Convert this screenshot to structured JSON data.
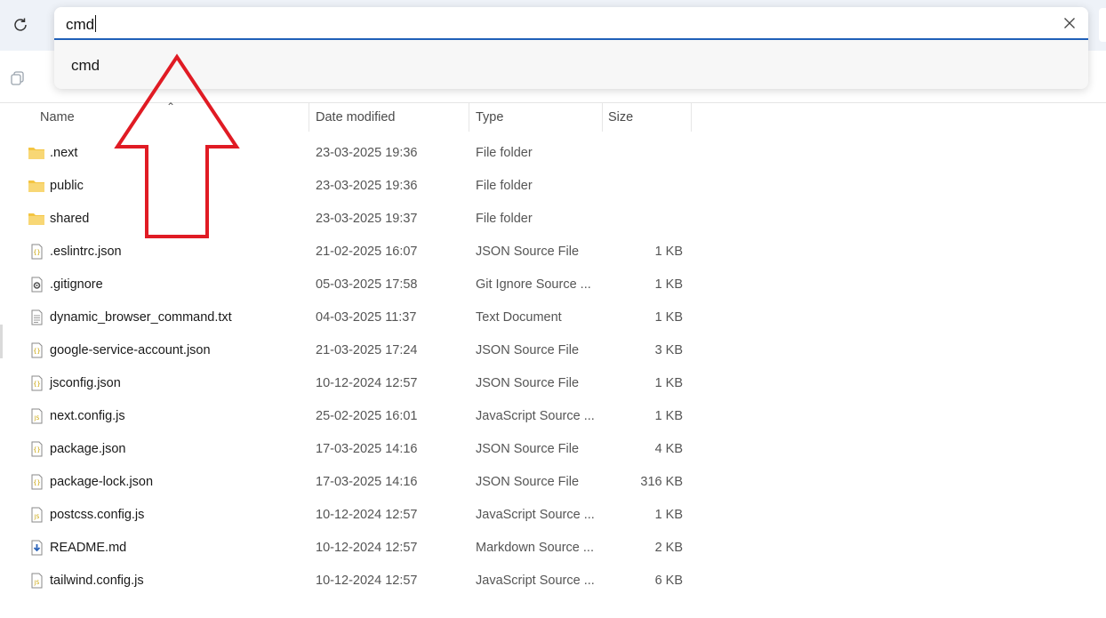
{
  "address_bar": {
    "value": "cmd",
    "suggestions": [
      {
        "label": "cmd"
      }
    ]
  },
  "columns": {
    "name": "Name",
    "date": "Date modified",
    "type": "Type",
    "size": "Size"
  },
  "files": [
    {
      "name": ".next",
      "date": "23-03-2025 19:36",
      "type": "File folder",
      "size": "",
      "icon": "folder-icon"
    },
    {
      "name": "public",
      "date": "23-03-2025 19:36",
      "type": "File folder",
      "size": "",
      "icon": "folder-icon"
    },
    {
      "name": "shared",
      "date": "23-03-2025 19:37",
      "type": "File folder",
      "size": "",
      "icon": "folder-icon"
    },
    {
      "name": ".eslintrc.json",
      "date": "21-02-2025 16:07",
      "type": "JSON Source File",
      "size": "1 KB",
      "icon": "json-file-icon"
    },
    {
      "name": ".gitignore",
      "date": "05-03-2025 17:58",
      "type": "Git Ignore Source ...",
      "size": "1 KB",
      "icon": "settings-file-icon"
    },
    {
      "name": "dynamic_browser_command.txt",
      "date": "04-03-2025 11:37",
      "type": "Text Document",
      "size": "1 KB",
      "icon": "text-file-icon"
    },
    {
      "name": "google-service-account.json",
      "date": "21-03-2025 17:24",
      "type": "JSON Source File",
      "size": "3 KB",
      "icon": "json-file-icon"
    },
    {
      "name": "jsconfig.json",
      "date": "10-12-2024 12:57",
      "type": "JSON Source File",
      "size": "1 KB",
      "icon": "json-file-icon"
    },
    {
      "name": "next.config.js",
      "date": "25-02-2025 16:01",
      "type": "JavaScript Source ...",
      "size": "1 KB",
      "icon": "js-file-icon"
    },
    {
      "name": "package.json",
      "date": "17-03-2025 14:16",
      "type": "JSON Source File",
      "size": "4 KB",
      "icon": "json-file-icon"
    },
    {
      "name": "package-lock.json",
      "date": "17-03-2025 14:16",
      "type": "JSON Source File",
      "size": "316 KB",
      "icon": "json-file-icon"
    },
    {
      "name": "postcss.config.js",
      "date": "10-12-2024 12:57",
      "type": "JavaScript Source ...",
      "size": "1 KB",
      "icon": "js-file-icon"
    },
    {
      "name": "README.md",
      "date": "10-12-2024 12:57",
      "type": "Markdown Source ...",
      "size": "2 KB",
      "icon": "markdown-file-icon"
    },
    {
      "name": "tailwind.config.js",
      "date": "10-12-2024 12:57",
      "type": "JavaScript Source ...",
      "size": "6 KB",
      "icon": "js-file-icon"
    }
  ],
  "colors": {
    "accent": "#1f5fb8",
    "annotation_arrow": "#e01b24",
    "folder": "#f4c542"
  }
}
